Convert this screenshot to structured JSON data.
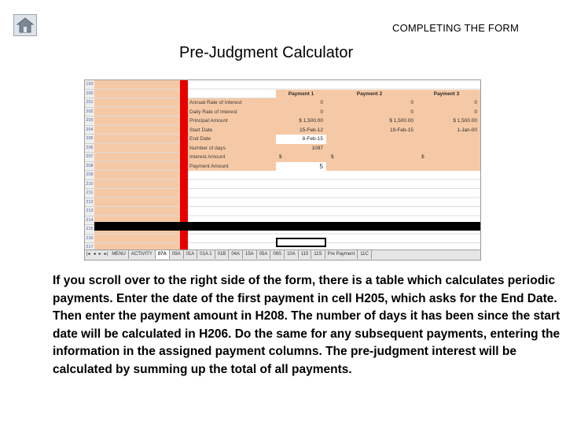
{
  "header": {
    "section_title": "COMPLETING THE FORM",
    "slide_title": "Pre-Judgment Calculator",
    "home_icon": "home-icon"
  },
  "spreadsheet": {
    "row_numbers": [
      "193",
      "200",
      "201",
      "202",
      "203",
      "204",
      "205",
      "206",
      "207",
      "208",
      "209",
      "210",
      "211",
      "212",
      "213",
      "214",
      "215",
      "216",
      "217",
      "218"
    ],
    "labels": [
      "Annual Rate of Interest",
      "Daily Rate of Interest",
      "Principal Amount",
      "Start Date",
      "End Date",
      "Number of days",
      "Interest Amount",
      "Payment Amount"
    ],
    "payment_headers": [
      "Payment 1",
      "Payment 2",
      "Payment 3"
    ],
    "payment1": [
      "0",
      "0",
      "$   1,500.00",
      "15-Feb-12",
      "8-Feb-15",
      "1097",
      "$",
      "5"
    ],
    "payment2": [
      "0",
      "0",
      "$   1,500.00",
      "19-Feb-15",
      "",
      "",
      "$",
      ""
    ],
    "payment3": [
      "0",
      "0",
      "$   1,500.00",
      "1-Jan-00",
      "",
      "",
      "$",
      ""
    ],
    "tabs": [
      "MENU",
      "ACTIVITY",
      "07A",
      "09A",
      "01A",
      "01A 1",
      "01B",
      "04A",
      "15A",
      "05A",
      "06S",
      "10A",
      "115",
      "11S",
      "Pre Payment",
      "11C"
    ],
    "active_tab": "07A"
  },
  "body": {
    "parts": [
      "If you scroll over to the right side of the form, there is a table which calculates periodic payments.  Enter the date of the first payment in cell ",
      "H205",
      ", which asks for the End Date.  Then enter the payment amount in ",
      "H208",
      ". The number of days it has been since the start date will be calculated in ",
      "H206",
      ". Do the same for any subsequent payments, entering the information in the assigned payment columns. The pre-judgment interest will be calculated by summing up the total of all payments."
    ]
  }
}
